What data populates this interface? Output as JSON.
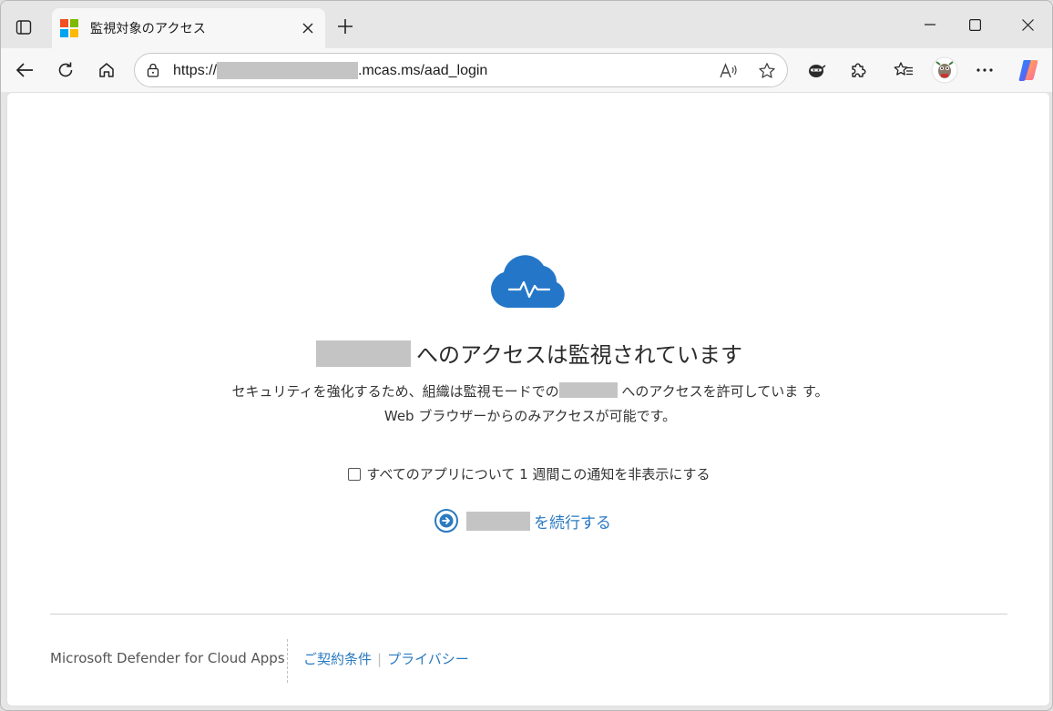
{
  "browser": {
    "tab": {
      "title": "監視対象のアクセス",
      "close_glyph": "✕"
    },
    "new_tab_glyph": "+",
    "address": {
      "url_prefix": "https://",
      "url_suffix": ".mcas.ms/aad_login"
    },
    "more_glyph": "···"
  },
  "page": {
    "headline": "へのアクセスは監視されています",
    "description_part1": "セキュリティを強化するため、組織は監視モードでの",
    "description_part2": "へのアクセスを許可していま す。",
    "description_line2": "Web ブラウザーからのみアクセスが可能です。",
    "checkbox_label": "すべてのアプリについて 1 週間この通知を非表示にする",
    "continue_label": "を続行する",
    "cloud_icon_color": "#2477c8",
    "link_color": "#2a7ac0"
  },
  "footer": {
    "brand": "Microsoft Defender for Cloud Apps",
    "terms_link": "ご契約条件",
    "privacy_link": "プライバシー",
    "separator": "|"
  },
  "icons": {
    "favicon_colors": [
      "#f25022",
      "#7fba00",
      "#00a4ef",
      "#ffb900"
    ]
  }
}
